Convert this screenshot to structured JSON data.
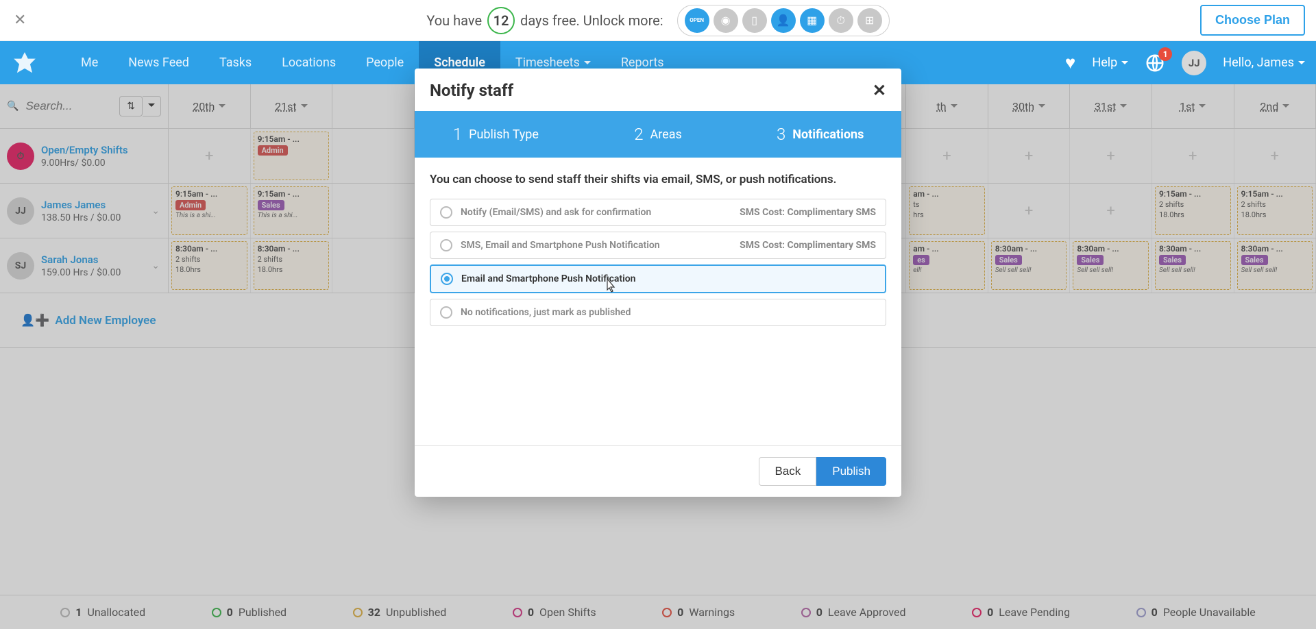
{
  "trial": {
    "prefix": "You have",
    "days": "12",
    "suffix": "days free. Unlock more:",
    "choose_plan": "Choose Plan"
  },
  "nav": {
    "items": [
      "Me",
      "News Feed",
      "Tasks",
      "Locations",
      "People",
      "Schedule",
      "Timesheets",
      "Reports"
    ],
    "active_index": 5,
    "help": "Help",
    "notifications_count": "1",
    "user_initials": "JJ",
    "greeting": "Hello, James"
  },
  "toolbar": {
    "search_placeholder": "Search...",
    "dates": [
      "20th",
      "21st",
      "",
      "",
      "",
      "",
      "",
      "",
      "",
      "th",
      "30th",
      "31st",
      "1st",
      "2nd"
    ]
  },
  "rows": [
    {
      "avatar_type": "pink",
      "avatar_text": "⏱",
      "name": "Open/Empty Shifts",
      "sub": "9.00Hrs/ $0.00",
      "cells": [
        {
          "plus": true
        },
        {
          "time": "9:15am - ...",
          "badge": "Admin",
          "badge_class": "admin"
        },
        {},
        {},
        {},
        {},
        {},
        {},
        {},
        {
          "plus": true
        },
        {
          "plus": true
        },
        {
          "plus": true
        },
        {
          "plus": true
        },
        {
          "plus": true
        }
      ]
    },
    {
      "avatar_text": "JJ",
      "name": "James James",
      "sub": "138.50 Hrs / $0.00",
      "chev": true,
      "cells": [
        {
          "time": "9:15am - ...",
          "badge": "Admin",
          "badge_class": "admin",
          "note": "This is a shi..."
        },
        {
          "time": "9:15am - ...",
          "badge": "Sales",
          "badge_class": "sales",
          "note": "This is a shi..."
        },
        {},
        {},
        {},
        {},
        {},
        {},
        {},
        {
          "time": "am - ...",
          "sub1": "ts",
          "sub2": "hrs"
        },
        {
          "plus": true
        },
        {
          "plus": true
        },
        {
          "time": "9:15am - ...",
          "sub1": "2 shifts",
          "sub2": "18.0hrs"
        },
        {
          "time": "9:15am - ...",
          "sub1": "2 shifts",
          "sub2": "18.0hrs"
        }
      ]
    },
    {
      "avatar_text": "SJ",
      "name": "Sarah Jonas",
      "sub": "159.00 Hrs / $0.00",
      "chev": true,
      "cells": [
        {
          "time": "8:30am - ...",
          "sub1": "2 shifts",
          "sub2": "18.0hrs"
        },
        {
          "time": "8:30am - ...",
          "sub1": "2 shifts",
          "sub2": "18.0hrs"
        },
        {},
        {},
        {},
        {},
        {},
        {},
        {},
        {
          "time": "am - ...",
          "badge": "es",
          "badge_class": "sales",
          "note": "ell!"
        },
        {
          "time": "8:30am - ...",
          "badge": "Sales",
          "badge_class": "sales",
          "note": "Sell sell sell!"
        },
        {
          "time": "8:30am - ...",
          "badge": "Sales",
          "badge_class": "sales",
          "note": "Sell sell sell!"
        },
        {
          "time": "8:30am - ...",
          "badge": "Sales",
          "badge_class": "sales",
          "note": "Sell sell sell!"
        },
        {
          "time": "8:30am - ...",
          "badge": "Sales",
          "badge_class": "sales",
          "note": "Sell sell sell!"
        }
      ]
    }
  ],
  "add_employee": "Add New Employee",
  "status": [
    {
      "count": "1",
      "label": "Unallocated",
      "color": "#bbb"
    },
    {
      "count": "0",
      "label": "Published",
      "color": "#3ab54a"
    },
    {
      "count": "32",
      "label": "Unpublished",
      "color": "#e0b040"
    },
    {
      "count": "0",
      "label": "Open Shifts",
      "color": "#d63384"
    },
    {
      "count": "0",
      "label": "Warnings",
      "color": "#e74c3c"
    },
    {
      "count": "0",
      "label": "Leave Approved",
      "color": "#b565a7"
    },
    {
      "count": "0",
      "label": "Leave Pending",
      "color": "#e91e63"
    },
    {
      "count": "0",
      "label": "People Unavailable",
      "color": "#9b9bcf"
    }
  ],
  "modal": {
    "title": "Notify staff",
    "steps": [
      {
        "num": "1",
        "label": "Publish Type"
      },
      {
        "num": "2",
        "label": "Areas"
      },
      {
        "num": "3",
        "label": "Notifications"
      }
    ],
    "active_step": 2,
    "description": "You can choose to send staff their shifts via email, SMS, or push notifications.",
    "options": [
      {
        "label": "Notify (Email/SMS) and ask for confirmation",
        "cost": "SMS Cost: Complimentary SMS"
      },
      {
        "label": "SMS, Email and Smartphone Push Notification",
        "cost": "SMS Cost: Complimentary SMS"
      },
      {
        "label": "Email and Smartphone Push Notification",
        "cost": ""
      },
      {
        "label": "No notifications, just mark as published",
        "cost": ""
      }
    ],
    "selected_option": 2,
    "back": "Back",
    "publish": "Publish"
  }
}
